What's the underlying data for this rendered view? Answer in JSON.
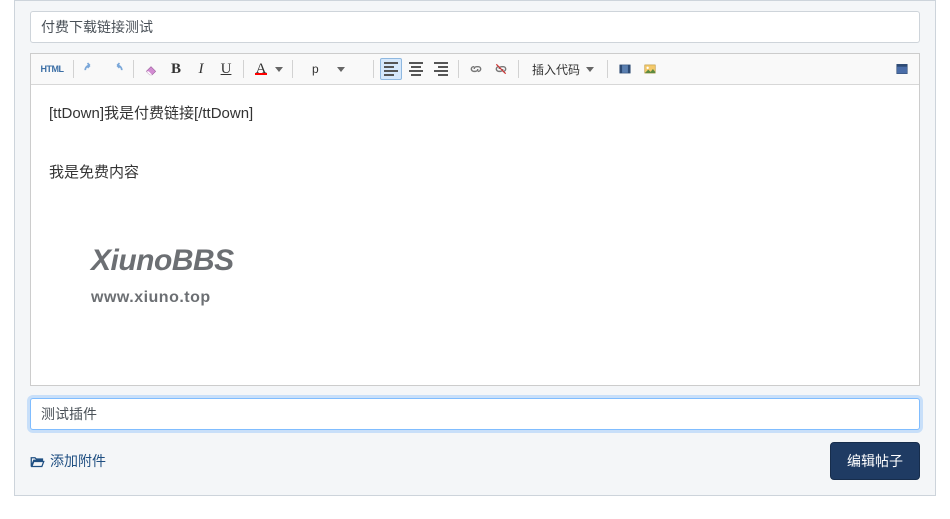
{
  "title_input": {
    "value": "付费下载链接测试"
  },
  "toolbar": {
    "html": "HTML",
    "paragraph_label": "p",
    "insert_code_label": "插入代码"
  },
  "editor": {
    "line1": "[ttDown]我是付费链接[/ttDown]",
    "line2": "我是免费内容"
  },
  "watermark": {
    "big": "XiunoBBS",
    "small": "www.xiuno.top"
  },
  "tags_input": {
    "value": "测试插件"
  },
  "attach_label": "添加附件",
  "submit_label": "编辑帖子"
}
